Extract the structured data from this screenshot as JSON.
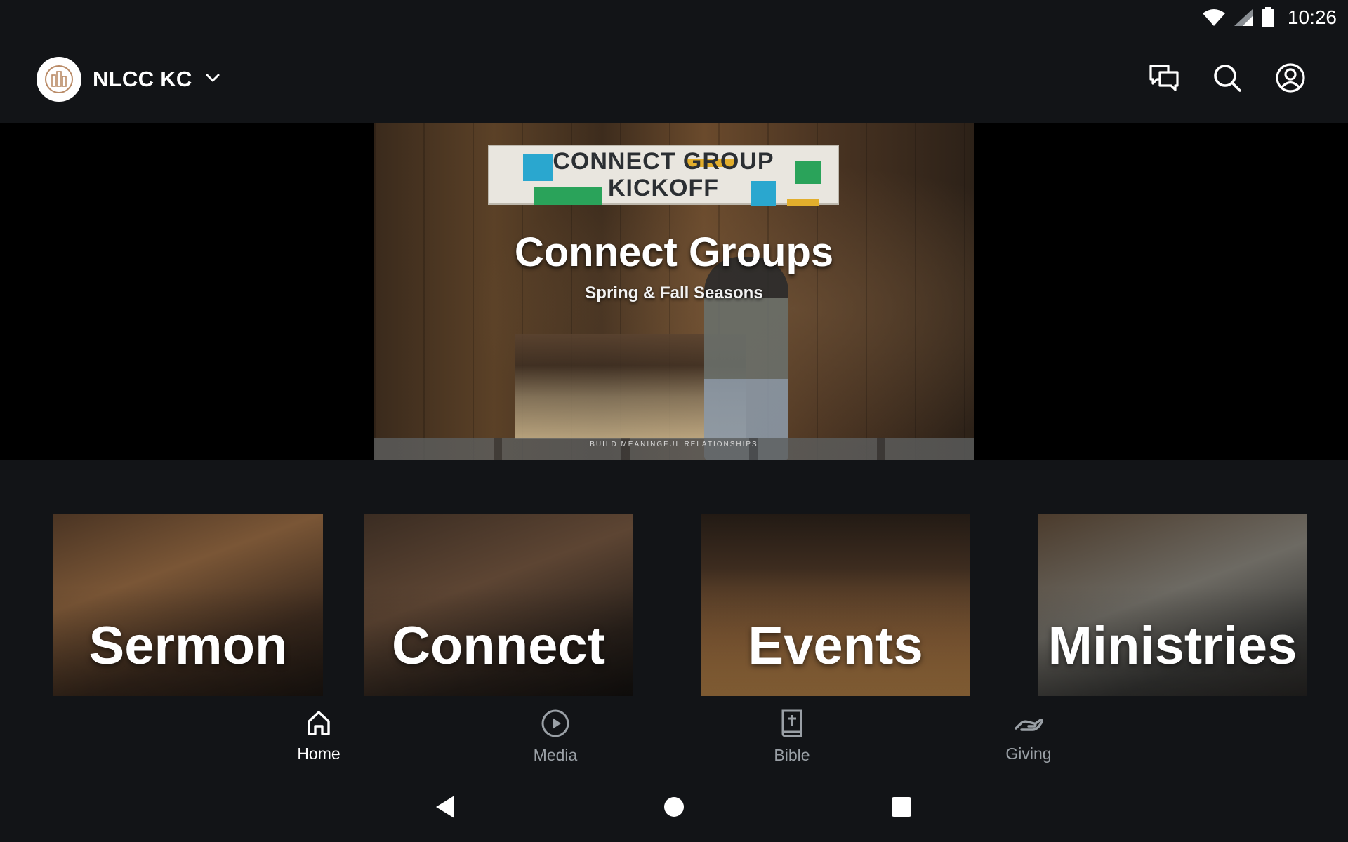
{
  "status_bar": {
    "time": "10:26",
    "icons": [
      "wifi-icon",
      "cellular-signal-icon",
      "battery-icon"
    ]
  },
  "header": {
    "org_name": "NLCC KC",
    "actions": [
      "chat-icon",
      "search-icon",
      "account-icon"
    ]
  },
  "hero": {
    "banner_line1": "CONNECT GROUP",
    "banner_line2": "KICKOFF",
    "title": "Connect Groups",
    "subtitle": "Spring & Fall Seasons",
    "tagline": "BUILD MEANINGFUL RELATIONSHIPS"
  },
  "tiles": [
    {
      "label": "Sermon"
    },
    {
      "label": "Connect"
    },
    {
      "label": "Events"
    },
    {
      "label": "Ministries"
    }
  ],
  "bottom_nav": {
    "items": [
      {
        "label": "Home",
        "icon": "home-icon",
        "active": true
      },
      {
        "label": "Media",
        "icon": "play-circle-icon",
        "active": false
      },
      {
        "label": "Bible",
        "icon": "bible-icon",
        "active": false
      },
      {
        "label": "Giving",
        "icon": "giving-hand-icon",
        "active": false
      }
    ]
  },
  "colors": {
    "background": "#121417",
    "hero_band": "#000000",
    "active_nav": "#ffffff",
    "inactive_nav": "#9aa0a6"
  }
}
